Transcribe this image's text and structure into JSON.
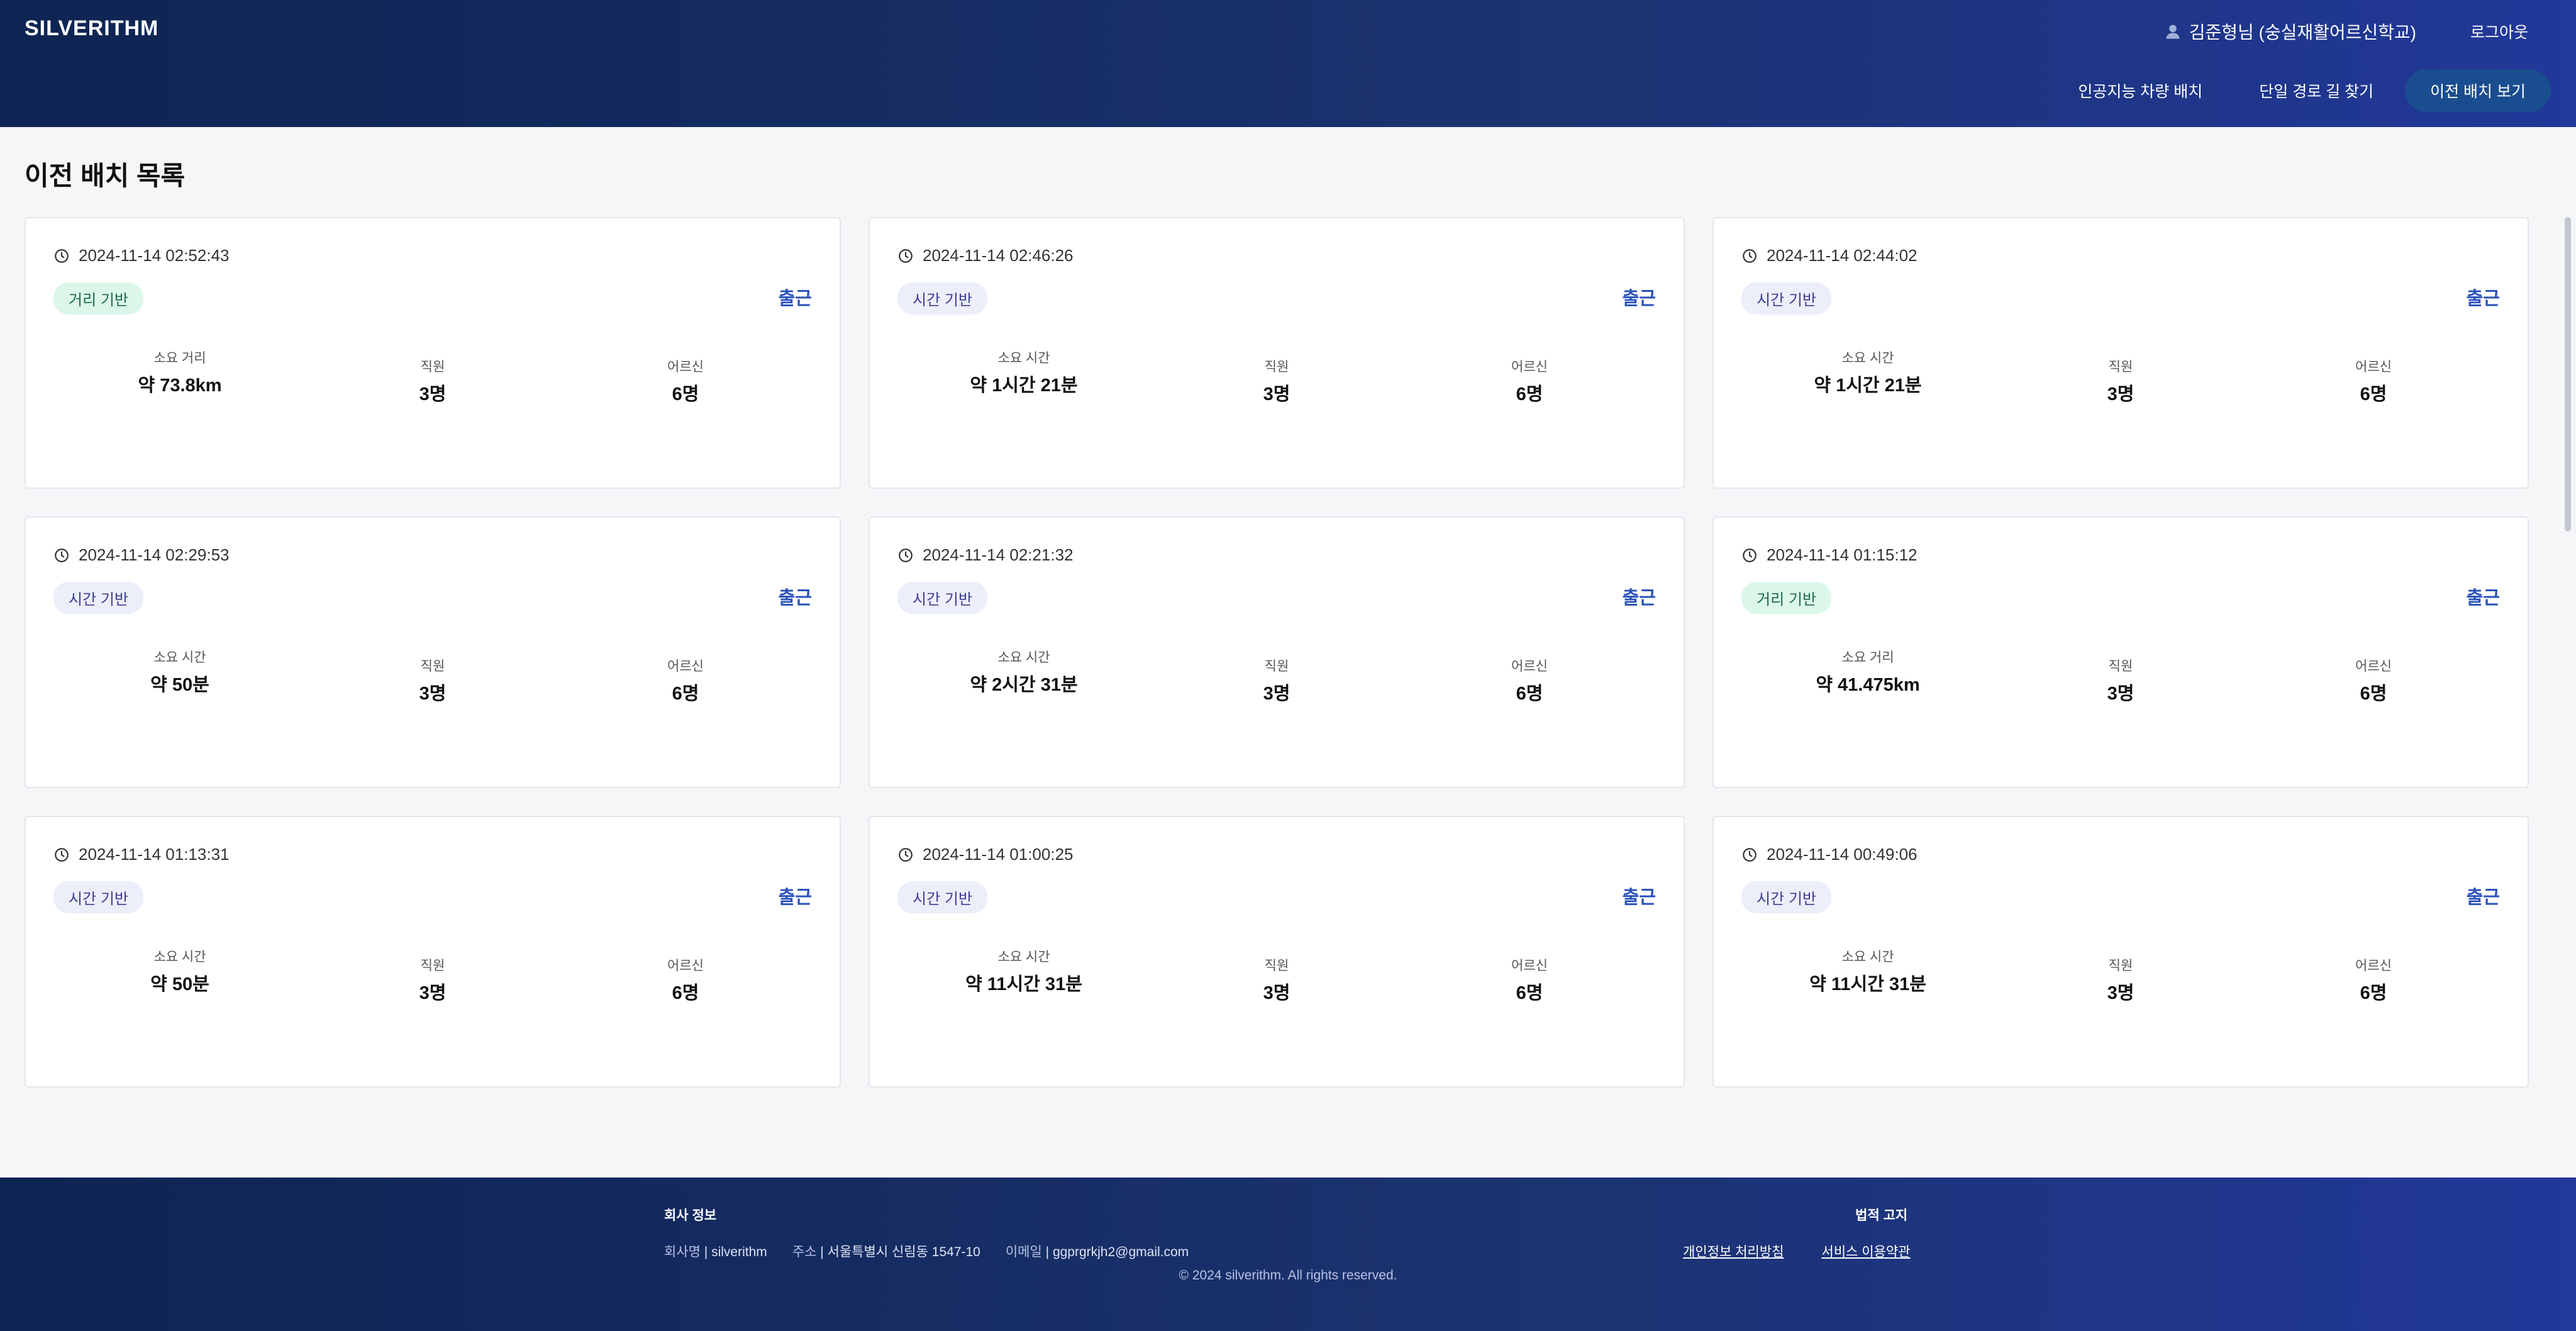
{
  "header": {
    "brand": "SILVERITHM",
    "user_label": "김준형님 (숭실재활어르신학교)",
    "logout_label": "로그아웃",
    "nav": [
      {
        "label": "인공지능 차량 배치"
      },
      {
        "label": "단일 경로 길 찾기"
      },
      {
        "label": "이전 배치 보기",
        "active": true
      }
    ]
  },
  "page_title": "이전 배치 목록",
  "cards": [
    {
      "timestamp": "2024-11-14 02:52:43",
      "tag": "거리 기반",
      "commute_label": "출근",
      "main_label": "소요 거리",
      "main_value": "약 73.8km",
      "staff_label": "직원",
      "staff_value": "3명",
      "elder_label": "어르신",
      "elder_value": "6명"
    },
    {
      "timestamp": "2024-11-14 02:46:26",
      "tag": "시간 기반",
      "commute_label": "출근",
      "main_label": "소요 시간",
      "main_value": "약 1시간 21분",
      "staff_label": "직원",
      "staff_value": "3명",
      "elder_label": "어르신",
      "elder_value": "6명"
    },
    {
      "timestamp": "2024-11-14 02:44:02",
      "tag": "시간 기반",
      "commute_label": "출근",
      "main_label": "소요 시간",
      "main_value": "약 1시간 21분",
      "staff_label": "직원",
      "staff_value": "3명",
      "elder_label": "어르신",
      "elder_value": "6명"
    },
    {
      "timestamp": "2024-11-14 02:29:53",
      "tag": "시간 기반",
      "commute_label": "출근",
      "main_label": "소요 시간",
      "main_value": "약 50분",
      "staff_label": "직원",
      "staff_value": "3명",
      "elder_label": "어르신",
      "elder_value": "6명"
    },
    {
      "timestamp": "2024-11-14 02:21:32",
      "tag": "시간 기반",
      "commute_label": "출근",
      "main_label": "소요 시간",
      "main_value": "약 2시간 31분",
      "staff_label": "직원",
      "staff_value": "3명",
      "elder_label": "어르신",
      "elder_value": "6명"
    },
    {
      "timestamp": "2024-11-14 01:15:12",
      "tag": "거리 기반",
      "commute_label": "출근",
      "main_label": "소요 거리",
      "main_value": "약 41.475km",
      "staff_label": "직원",
      "staff_value": "3명",
      "elder_label": "어르신",
      "elder_value": "6명"
    },
    {
      "timestamp": "2024-11-14 01:13:31",
      "tag": "시간 기반",
      "commute_label": "출근",
      "main_label": "소요 시간",
      "main_value": "약 50분",
      "staff_label": "직원",
      "staff_value": "3명",
      "elder_label": "어르신",
      "elder_value": "6명"
    },
    {
      "timestamp": "2024-11-14 01:00:25",
      "tag": "시간 기반",
      "commute_label": "출근",
      "main_label": "소요 시간",
      "main_value": "약 11시간 31분",
      "staff_label": "직원",
      "staff_value": "3명",
      "elder_label": "어르신",
      "elder_value": "6명"
    },
    {
      "timestamp": "2024-11-14 00:49:06",
      "tag": "시간 기반",
      "commute_label": "출근",
      "main_label": "소요 시간",
      "main_value": "약 11시간 31분",
      "staff_label": "직원",
      "staff_value": "3명",
      "elder_label": "어르신",
      "elder_value": "6명"
    }
  ],
  "footer": {
    "info_title": "회사 정보",
    "company_key": "회사명",
    "company_val": "silverithm",
    "address_key": "주소",
    "address_val": "서울특별시 신림동 1547-10",
    "email_key": "이메일",
    "email_val": "ggprgrkjh2@gmail.com",
    "legal_title": "법적 고지",
    "privacy_link": "개인정보 처리방침",
    "terms_link": "서비스 이용약관",
    "copyright": "© 2024 silverithm. All rights reserved."
  }
}
